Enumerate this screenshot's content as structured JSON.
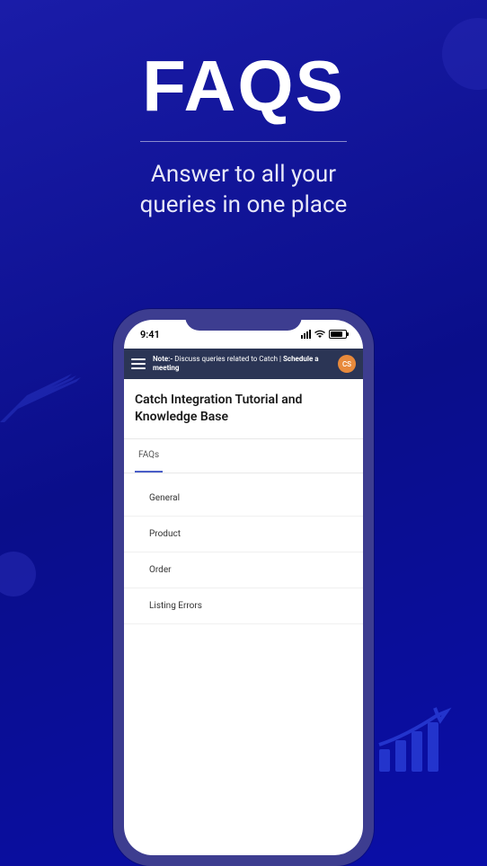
{
  "hero": {
    "title": "FAQS",
    "subtitle_line1": "Answer to all your",
    "subtitle_line2": "queries in one place"
  },
  "phone": {
    "status": {
      "time": "9:41"
    },
    "header": {
      "note_prefix": "Note:-",
      "note_text": " Discuss queries related to Catch | ",
      "schedule_text": "Schedule a meeting",
      "avatar_initials": "CS"
    },
    "page_title": "Catch Integration Tutorial and Knowledge Base",
    "tab_label": "FAQs",
    "faq_items": [
      "General",
      "Product",
      "Order",
      "Listing Errors"
    ]
  }
}
